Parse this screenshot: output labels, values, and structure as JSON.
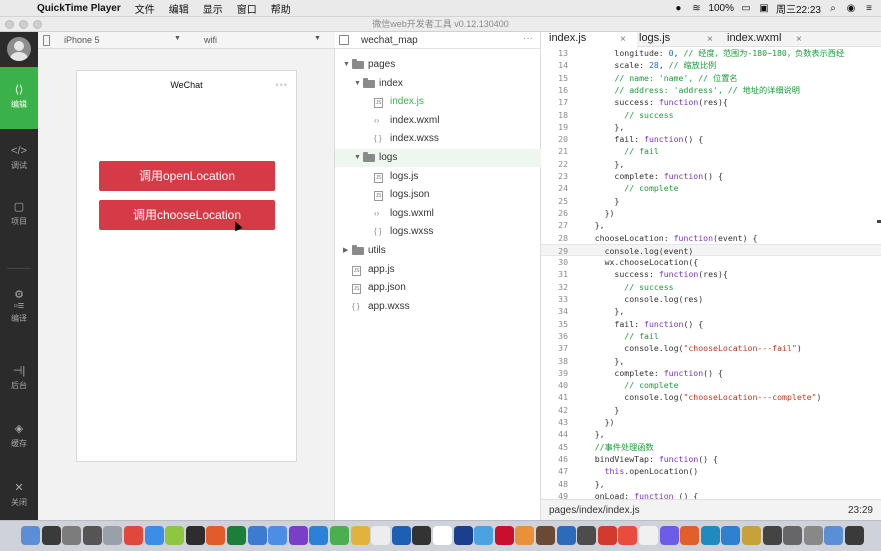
{
  "menubar": {
    "app_name": "QuickTime Player",
    "items": [
      "文件",
      "编辑",
      "显示",
      "窗口",
      "帮助"
    ],
    "battery": "100%",
    "clock": "周三22:23"
  },
  "window": {
    "title": "微信web开发者工具 v0.12.130400"
  },
  "sidebar": {
    "items": [
      {
        "label": "编辑",
        "icon": "code-icon"
      },
      {
        "label": "调试",
        "icon": "debug-icon"
      },
      {
        "label": "项目",
        "icon": "project-icon"
      },
      {
        "label": "编译",
        "icon": "compile-icon"
      },
      {
        "label": "后台",
        "icon": "backend-icon"
      },
      {
        "label": "缓存",
        "icon": "cache-icon"
      },
      {
        "label": "关闭",
        "icon": "close-icon"
      }
    ]
  },
  "simulator": {
    "device": "iPhone 5",
    "network": "wifi",
    "nav_title": "WeChat",
    "buttons": [
      "调用openLocation",
      "调用chooseLocation"
    ]
  },
  "filetree": {
    "project_name": "wechat_map",
    "rows": [
      {
        "name": "pages",
        "kind": "folder",
        "depth": 0
      },
      {
        "name": "index",
        "kind": "folder",
        "depth": 1
      },
      {
        "name": "index.js",
        "kind": "js",
        "depth": 2
      },
      {
        "name": "index.wxml",
        "kind": "wxml",
        "depth": 2
      },
      {
        "name": "index.wxss",
        "kind": "wxss",
        "depth": 2
      },
      {
        "name": "logs",
        "kind": "folder",
        "depth": 1
      },
      {
        "name": "logs.js",
        "kind": "js",
        "depth": 2
      },
      {
        "name": "logs.json",
        "kind": "json",
        "depth": 2
      },
      {
        "name": "logs.wxml",
        "kind": "wxml",
        "depth": 2
      },
      {
        "name": "logs.wxss",
        "kind": "wxss",
        "depth": 2
      },
      {
        "name": "utils",
        "kind": "folder",
        "depth": 0
      },
      {
        "name": "app.js",
        "kind": "js",
        "depth": 0
      },
      {
        "name": "app.json",
        "kind": "json",
        "depth": 0
      },
      {
        "name": "app.wxss",
        "kind": "wxss",
        "depth": 0
      }
    ]
  },
  "editor": {
    "tabs": [
      "index.js",
      "logs.js",
      "index.wxml"
    ],
    "status_path": "pages/index/index.js",
    "cursor_pos": "23:29",
    "lines": [
      {
        "n": "13",
        "t": "        longitude: 0, // 经度，范围为-180~180，负数表示西经"
      },
      {
        "n": "14",
        "t": "        scale: 28, // 缩放比例"
      },
      {
        "n": "15",
        "t": "        // name: 'name', // 位置名"
      },
      {
        "n": "16",
        "t": "        // address: 'address', // 地址的详细说明"
      },
      {
        "n": "17",
        "t": "        success: function(res){"
      },
      {
        "n": "18",
        "t": "          // success"
      },
      {
        "n": "19",
        "t": "        },"
      },
      {
        "n": "20",
        "t": "        fail: function() {"
      },
      {
        "n": "21",
        "t": "          // fail"
      },
      {
        "n": "22",
        "t": "        },"
      },
      {
        "n": "23",
        "t": "        complete: function() {"
      },
      {
        "n": "24",
        "t": "          // complete"
      },
      {
        "n": "25",
        "t": "        }"
      },
      {
        "n": "26",
        "t": "      })"
      },
      {
        "n": "27",
        "t": "    },"
      },
      {
        "n": "28",
        "t": "    chooseLocation: function(event) {"
      },
      {
        "n": "29",
        "t": "      console.log(event)"
      },
      {
        "n": "30",
        "t": "      wx.chooseLocation({"
      },
      {
        "n": "31",
        "t": "        success: function(res){"
      },
      {
        "n": "32",
        "t": "          // success"
      },
      {
        "n": "33",
        "t": "          console.log(res)"
      },
      {
        "n": "34",
        "t": "        },"
      },
      {
        "n": "35",
        "t": "        fail: function() {"
      },
      {
        "n": "36",
        "t": "          // fail"
      },
      {
        "n": "37",
        "t": "          console.log(\"chooseLocation---fail\")"
      },
      {
        "n": "38",
        "t": "        },"
      },
      {
        "n": "39",
        "t": "        complete: function() {"
      },
      {
        "n": "40",
        "t": "          // complete"
      },
      {
        "n": "41",
        "t": "          console.log(\"chooseLocation---complete\")"
      },
      {
        "n": "42",
        "t": "        }"
      },
      {
        "n": "43",
        "t": "      })"
      },
      {
        "n": "44",
        "t": "    },"
      },
      {
        "n": "45",
        "t": "    //事件处理函数"
      },
      {
        "n": "46",
        "t": "    bindViewTap: function() {"
      },
      {
        "n": "47",
        "t": "      this.openLocation()"
      },
      {
        "n": "48",
        "t": "    },"
      },
      {
        "n": "49",
        "t": "    onLoad: function () {"
      }
    ]
  },
  "colors": {
    "accent_green": "#3bb14a",
    "button_red": "#d53a47",
    "sidebar_dark": "#2b2b2b"
  }
}
